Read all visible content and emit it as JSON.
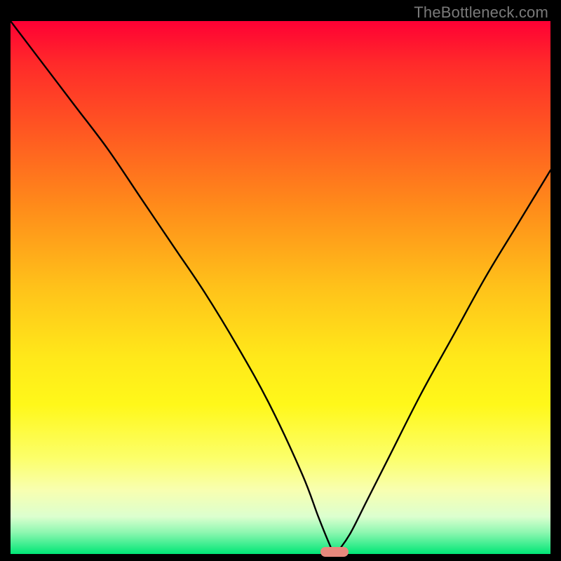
{
  "watermark": "TheBottleneck.com",
  "accent_color": "#e8897d",
  "chart_data": {
    "type": "line",
    "title": "",
    "xlabel": "",
    "ylabel": "",
    "xlim": [
      0,
      100
    ],
    "ylim": [
      0,
      100
    ],
    "series": [
      {
        "name": "curve",
        "x": [
          0,
          6,
          12,
          18,
          24,
          30,
          36,
          42,
          48,
          54,
          57,
          59,
          60,
          61,
          63,
          66,
          70,
          76,
          82,
          88,
          94,
          100
        ],
        "values": [
          100,
          92,
          84,
          76,
          67,
          58,
          49,
          39,
          28,
          15,
          7,
          2,
          0,
          1,
          4,
          10,
          18,
          30,
          41,
          52,
          62,
          72
        ]
      }
    ],
    "marker": {
      "x": 60,
      "y": 0,
      "color": "#e8897d"
    }
  }
}
